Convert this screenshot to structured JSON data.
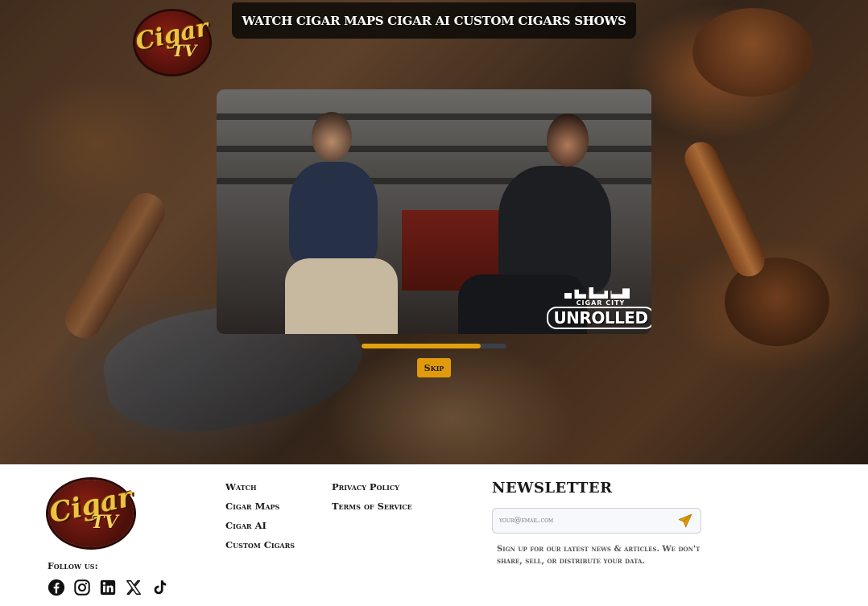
{
  "brand": {
    "logo_word1": "Cigar",
    "logo_word2": "TV"
  },
  "nav": {
    "items": [
      {
        "label": "WATCH"
      },
      {
        "label": "CIGAR MAPS"
      },
      {
        "label": "CIGAR AI"
      },
      {
        "label": "CUSTOM CIGARS"
      },
      {
        "label": "SHOWS"
      }
    ]
  },
  "video": {
    "badge_sub": "CIGAR CITY",
    "badge_main": "UNROLLED",
    "progress_fraction": 0.82
  },
  "skip_label": "Skip",
  "footer": {
    "follow_label": "Follow us:",
    "socials": [
      "facebook-icon",
      "instagram-icon",
      "linkedin-icon",
      "x-icon",
      "tiktok-icon"
    ],
    "links_col1": [
      "Watch",
      "Cigar Maps",
      "Cigar AI",
      "Custom Cigars"
    ],
    "links_col2": [
      "Privacy Policy",
      "Terms of Service"
    ],
    "newsletter": {
      "title": "NEWSLETTER",
      "placeholder": "your@email.com",
      "note": "Sign up for our latest news & articles. We don't share, sell, or distribute your data."
    }
  },
  "colors": {
    "accent": "#e09a0c",
    "nav_bg": "#0a0806",
    "progress_track": "#3c3f4a"
  }
}
